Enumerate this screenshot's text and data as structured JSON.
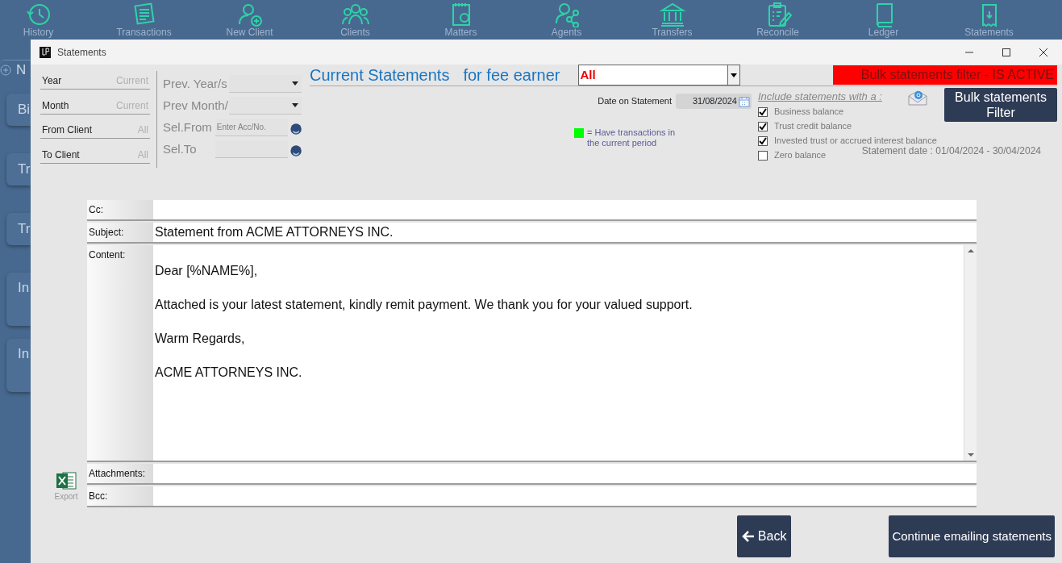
{
  "app_nav": [
    {
      "label": "History"
    },
    {
      "label": "Transactions"
    },
    {
      "label": "New Client"
    },
    {
      "label": "Clients"
    },
    {
      "label": "Matters"
    },
    {
      "label": "Agents"
    },
    {
      "label": "Transfers"
    },
    {
      "label": "Reconcile"
    },
    {
      "label": "Ledger"
    },
    {
      "label": "Statements"
    }
  ],
  "sidebar": [
    {
      "label": "N",
      "kind": "add"
    },
    {
      "label": "Bi",
      "kind": "tile"
    },
    {
      "label": "Tr",
      "kind": "tile"
    },
    {
      "label": "Tr",
      "kind": "tile"
    },
    {
      "label": "In",
      "kind": "tall"
    },
    {
      "label": "In",
      "kind": "tall"
    }
  ],
  "dialog": {
    "title": "Statements"
  },
  "filters": [
    {
      "label": "Year",
      "placeholder": "Current"
    },
    {
      "label": "Month",
      "placeholder": "Current"
    },
    {
      "label": "From Client",
      "placeholder": "All"
    },
    {
      "label": "To Client",
      "placeholder": "All"
    }
  ],
  "period_filters": [
    {
      "label": "Prev. Year/s",
      "kind": "dropdown"
    },
    {
      "label": "Prev Month/",
      "kind": "dropdown"
    },
    {
      "label": "Sel.From",
      "kind": "lookup",
      "placeholder": "Enter Acc/No."
    },
    {
      "label": "Sel.To",
      "kind": "lookup"
    }
  ],
  "heading": {
    "title": "Current Statements",
    "subtitle": "for fee earner"
  },
  "fee_earner_select": {
    "value": "All"
  },
  "bulk_banner": "Bulk statements filter - IS ACTIVE",
  "date_on_statement": {
    "label": "Date on Statement",
    "value": "31/08/2024"
  },
  "legend": {
    "text": "= Have transactions in the current period"
  },
  "include": {
    "title": "Include statements with a :",
    "options": [
      {
        "label": "Business balance",
        "checked": true
      },
      {
        "label": "Trust credit balance",
        "checked": true
      },
      {
        "label": "Invested trust or accrued interest balance",
        "checked": true
      },
      {
        "label": "Zero balance",
        "checked": false
      }
    ]
  },
  "statement_date": "Statement date : 01/04/2024 - 30/04/2024",
  "bulk_button": "Bulk statements Filter",
  "email_fields": [
    {
      "label": "Cc:",
      "kind": "line"
    },
    {
      "label": "Subject:",
      "kind": "line",
      "value": "Statement from ACME ATTORNEYS INC."
    },
    {
      "label": "Content:",
      "kind": "body",
      "paragraphs": [
        "Dear [%NAME%],",
        "Attached is your latest statement, kindly remit payment.  We thank you for your valued support.",
        "Warm Regards,",
        "ACME ATTORNEYS INC."
      ]
    },
    {
      "label": "Attachments:",
      "kind": "line"
    },
    {
      "label": "Bcc:",
      "kind": "line"
    }
  ],
  "export": {
    "label": "Export"
  },
  "buttons": {
    "back": "Back",
    "continue": "Continue emailing statements"
  }
}
